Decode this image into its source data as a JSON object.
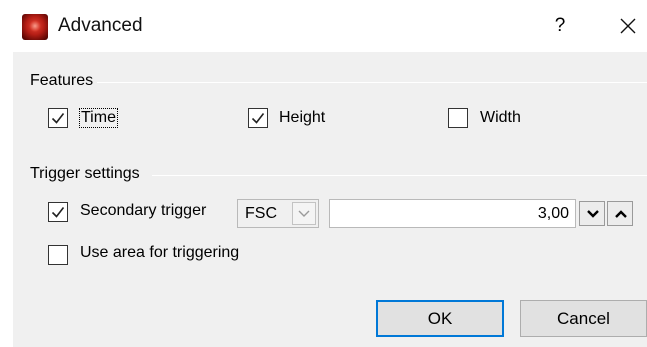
{
  "window": {
    "title": "Advanced",
    "help_label": "?"
  },
  "features": {
    "group_label": "Features",
    "time": {
      "label": "Time",
      "checked": true
    },
    "height": {
      "label": "Height",
      "checked": true
    },
    "width": {
      "label": "Width",
      "checked": false
    }
  },
  "trigger": {
    "group_label": "Trigger settings",
    "secondary": {
      "label": "Secondary trigger",
      "checked": true
    },
    "channel": {
      "value": "FSC"
    },
    "threshold": {
      "value": "3,00"
    },
    "use_area": {
      "label": "Use area for triggering",
      "checked": false
    }
  },
  "buttons": {
    "ok_label": "OK",
    "cancel_label": "Cancel"
  },
  "icons": {
    "app": "app-logo-icon",
    "close": "close-icon",
    "check": "checkmark-icon",
    "dropdown": "chevron-down-icon",
    "spin_down": "chevron-down-icon",
    "spin_up": "chevron-up-icon"
  },
  "colors": {
    "default_button_border": "#0078d7",
    "client_background": "#f0f0f0"
  }
}
